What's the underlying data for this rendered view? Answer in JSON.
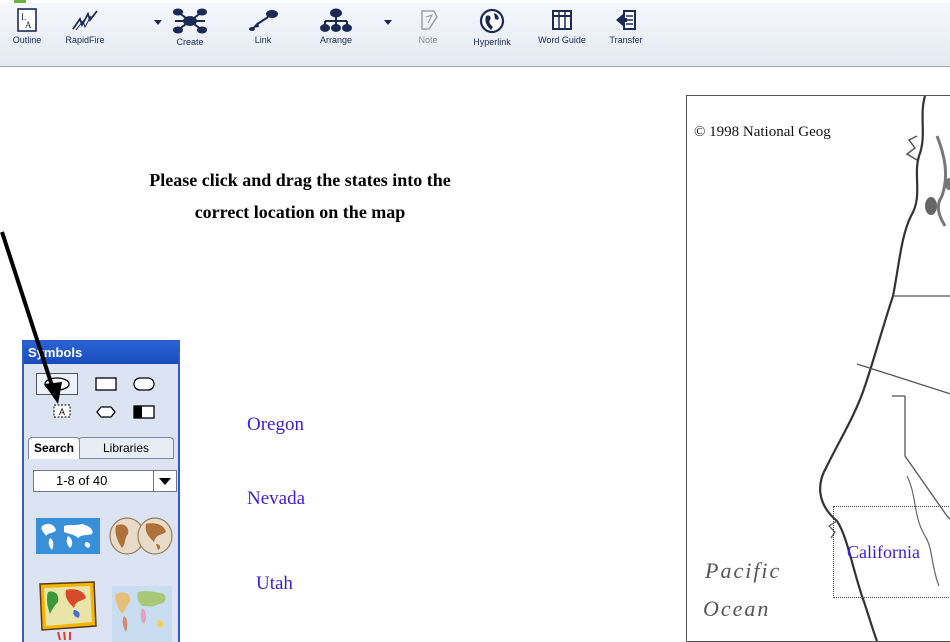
{
  "toolbar": {
    "buttons": [
      {
        "label": "Outline",
        "icon": "outline-icon"
      },
      {
        "label": "RapidFire",
        "icon": "rapidfire-icon"
      },
      {
        "label": "Create",
        "icon": "create-icon"
      },
      {
        "label": "Link",
        "icon": "link-icon"
      },
      {
        "label": "Arrange",
        "icon": "arrange-icon"
      },
      {
        "label": "Note",
        "icon": "note-icon"
      },
      {
        "label": "Hyperlink",
        "icon": "hyperlink-icon"
      },
      {
        "label": "Word Guide",
        "icon": "word-guide-icon"
      },
      {
        "label": "Transfer",
        "icon": "transfer-icon"
      }
    ]
  },
  "instructions": {
    "line1": "Please click and drag the states into the",
    "line2": "correct location on the map"
  },
  "states": [
    "Oregon",
    "Nevada",
    "Utah"
  ],
  "palette": {
    "title": "Symbols",
    "tabs": {
      "search": "Search",
      "libraries": "Libraries"
    },
    "range": "1-8 of 40",
    "clipart": [
      "world-map-blue",
      "world-map-sepia",
      "world-map-colored",
      "world-map-political"
    ]
  },
  "map": {
    "copyright": "© 1998 National Geog",
    "ocean_line1": "Pacific",
    "ocean_line2": "Ocean",
    "placed_label": "California"
  },
  "colors": {
    "state_label": "#3a1ed0",
    "palette_title": "#2a63d6",
    "palette_bg": "#dce4f4",
    "toolbar_text": "#1a2a55"
  }
}
